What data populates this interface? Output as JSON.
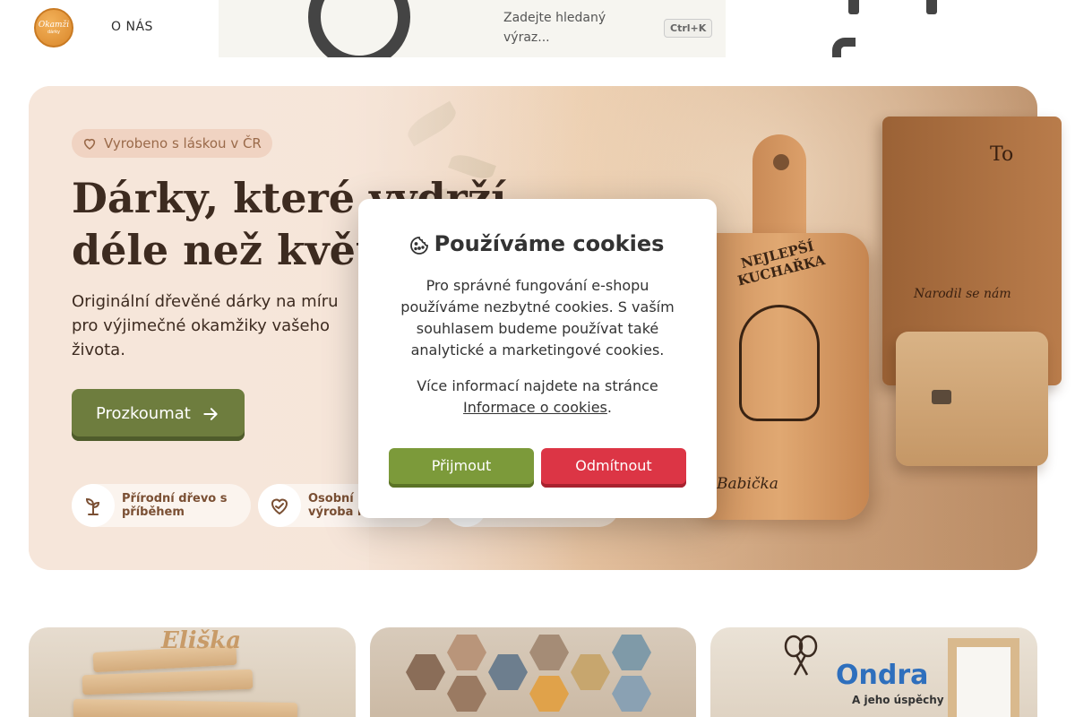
{
  "header": {
    "logo_text": "Okamži",
    "logo_sub": "dárky",
    "nav_about": "O NÁS",
    "search_placeholder": "Zadejte hledaný výraz...",
    "search_shortcut": "Ctrl+K"
  },
  "hero": {
    "badge": "Vyrobeno s láskou v ČR",
    "title_line1": "Dárky, které vydrží",
    "title_line2": "déle než květiny",
    "subtitle": "Originální dřevěné dárky na míru pro výjimečné okamžiky vašeho života.",
    "cta": "Prozkoumat",
    "features": [
      {
        "label": "Přírodní dřevo s příběhem",
        "icon": "sprout-icon"
      },
      {
        "label": "Osobní přístup a výroba na míru",
        "icon": "heart-hand-icon"
      },
      {
        "label": "",
        "icon": "feature-icon"
      }
    ],
    "board_title": "NEJLEPŠÍ KUCHAŘKA",
    "board_signature": "Babička",
    "notebook_text": "Narodil se nám",
    "notebook_top": "To"
  },
  "cookie_modal": {
    "title": "Používáme cookies",
    "text1": "Pro správné fungování e-shopu používáme nezbytné cookies. S vaším souhlasem budeme používat také analytické a marketingové cookies.",
    "text2_prefix": "Více informací najdete na stránce",
    "text2_link": "Informace o cookies",
    "text2_suffix": ".",
    "accept": "Přijmout",
    "reject": "Odmítnout"
  },
  "cards": [
    {
      "name_text": "Eliška"
    },
    {
      "name_text": ""
    },
    {
      "name_text": "Ondra",
      "sub_text": "A jeho úspěchy"
    }
  ],
  "colors": {
    "accent_green": "#6e7d3e",
    "accept_green": "#7c9a3a",
    "reject_red": "#dc3545",
    "hero_bg": "#f5e4d8",
    "title_brown": "#3d2b20"
  }
}
